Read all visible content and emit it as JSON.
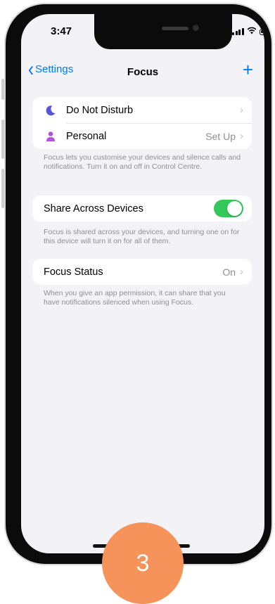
{
  "status_bar": {
    "time": "3:47"
  },
  "nav": {
    "back_label": "Settings",
    "title": "Focus",
    "add_symbol": "+"
  },
  "focus_modes": [
    {
      "label": "Do Not Disturb",
      "detail": "",
      "icon": "moon-icon",
      "color": "#5856d6"
    },
    {
      "label": "Personal",
      "detail": "Set Up",
      "icon": "person-icon",
      "color": "#af52de"
    }
  ],
  "focus_note": "Focus lets you customise your devices and silence calls and notifications. Turn it on and off in Control Centre.",
  "share": {
    "label": "Share Across Devices",
    "on": true,
    "note": "Focus is shared across your devices, and turning one on for this device will turn it on for all of them."
  },
  "focus_status": {
    "label": "Focus Status",
    "value": "On",
    "note": "When you give an app permission, it can share that you have notifications silenced when using Focus."
  },
  "step_badge": "3",
  "colors": {
    "accent": "#007aff",
    "toggle_on": "#34c759",
    "badge": "#f5935a"
  }
}
